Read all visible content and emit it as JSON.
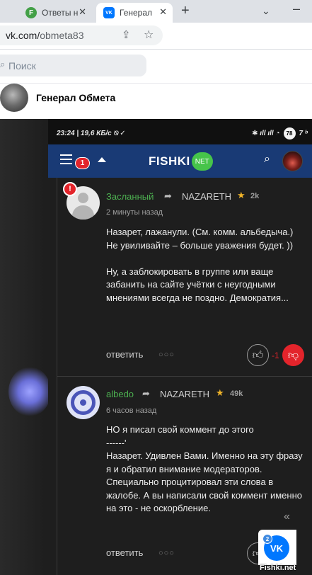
{
  "browser": {
    "tabs": [
      {
        "title": "Ответы н",
        "favicon": "F",
        "active": false
      },
      {
        "title": "Генерал",
        "favicon": "VK",
        "active": true
      }
    ],
    "new_tab_symbol": "+",
    "close_symbol": "✕",
    "tab_menu_symbol": "⌄",
    "minimize_symbol": "–",
    "url_host": "vk.com/",
    "url_path": "obmeta83"
  },
  "vk": {
    "search_placeholder": "Поиск",
    "profile_name": "Генерал Обмета"
  },
  "phone": {
    "status_left": "23:24 | 19,6 КБ/с ⍉ ✓",
    "status_right_icons": "✱ ıll ıll ◔",
    "battery": "78",
    "status_extra": "7 ᵇ"
  },
  "fishki": {
    "menu_badge": "1",
    "logo_word": "FISHKI",
    "logo_badge": "NET",
    "search_icon": "⌕"
  },
  "comments": [
    {
      "author": "Засланный",
      "arrow": "➦",
      "target": "NAZARETH",
      "rating": "2k",
      "time": "2 минуты назад",
      "text": "Назарет, лажанули. (См. комм. альбедыча.) Не увиливайте – больше уважения будет. ))\n\nНу, а заблокировать в группе или ваще забанить на сайте учётки с неугодными мнениями всегда не поздно. Демократия...",
      "reply": "ответить",
      "dots": "○○○",
      "score": "-1"
    },
    {
      "author": "albedo",
      "arrow": "➦",
      "target": "NAZARETH",
      "rating": "49k",
      "time": "6 часов назад",
      "text": "НО я писал свой коммент до этого\n------'\nНазарет. Удивлен Вами. Именно на эту фразу я и обратил внимание модераторов. Специально процитировал эти слова в жалобе. А вы написали свой коммент именно на это - не оскорбление.",
      "reply": "ответить",
      "dots": "○○○"
    }
  ],
  "widgets": {
    "collapse_symbol": "«",
    "vk_count": "2",
    "vk_logo": "VK",
    "watermark": "Fishki.net"
  },
  "colors": {
    "fishki_header": "#193a75",
    "author_green": "#4caf50",
    "downvote_red": "#e3242b",
    "vk_blue": "#0077ff"
  }
}
